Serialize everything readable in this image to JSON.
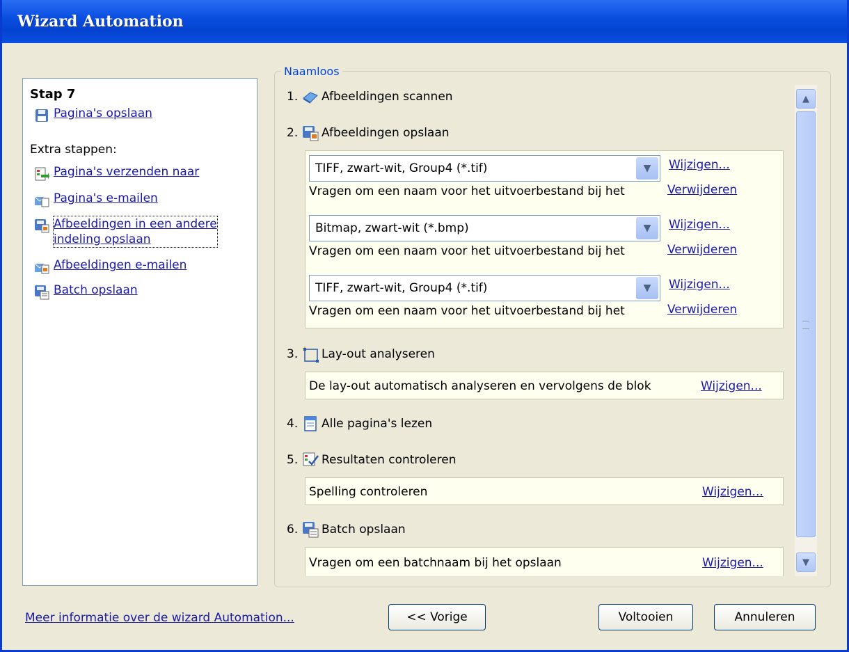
{
  "window": {
    "title": "Wizard Automation"
  },
  "left_panel": {
    "step_title": "Stap 7",
    "main_link": "Pagina's opslaan",
    "extra_label": "Extra stappen:",
    "extra_links": [
      "Pagina's verzenden naar",
      "Pagina's e-mailen",
      "Afbeeldingen in een andere",
      "indeling opslaan",
      "Afbeeldingen e-mailen",
      "Batch opslaan"
    ]
  },
  "group": {
    "legend": "Naamloos",
    "steps": [
      {
        "num": "1.",
        "label": "Afbeeldingen scannen",
        "icon": "scanner-icon"
      },
      {
        "num": "2.",
        "label": "Afbeeldingen opslaan",
        "icon": "save-image-icon"
      },
      {
        "num": "3.",
        "label": "Lay-out analyseren",
        "icon": "layout-icon"
      },
      {
        "num": "4.",
        "label": "Alle pagina's lezen",
        "icon": "read-page-icon"
      },
      {
        "num": "5.",
        "label": "Resultaten controleren",
        "icon": "check-results-icon"
      },
      {
        "num": "6.",
        "label": "Batch opslaan",
        "icon": "save-batch-icon"
      }
    ],
    "save_entries": [
      {
        "format": "TIFF, zwart-wit, Group4 (*.tif)",
        "desc": "Vragen om een naam voor het uitvoerbestand bij het",
        "modify": "Wijzigen...",
        "remove": "Verwijderen"
      },
      {
        "format": "Bitmap, zwart-wit (*.bmp)",
        "desc": "Vragen om een naam voor het uitvoerbestand bij het",
        "modify": "Wijzigen...",
        "remove": "Verwijderen"
      },
      {
        "format": "TIFF, zwart-wit, Group4 (*.tif)",
        "desc": "Vragen om een naam voor het uitvoerbestand bij het",
        "modify": "Wijzigen...",
        "remove": "Verwijderen"
      }
    ],
    "layout_desc": "De lay-out automatisch analyseren en vervolgens de blok",
    "layout_modify": "Wijzigen...",
    "check_desc": "Spelling controleren",
    "check_modify": "Wijzigen...",
    "batch_desc": "Vragen om een batchnaam bij het opslaan",
    "batch_modify": "Wijzigen..."
  },
  "footer": {
    "info_link": "Meer informatie over de wizard Automation...",
    "prev_button": "<< Vorige",
    "finish_button": "Voltooien",
    "cancel_button": "Annuleren"
  }
}
